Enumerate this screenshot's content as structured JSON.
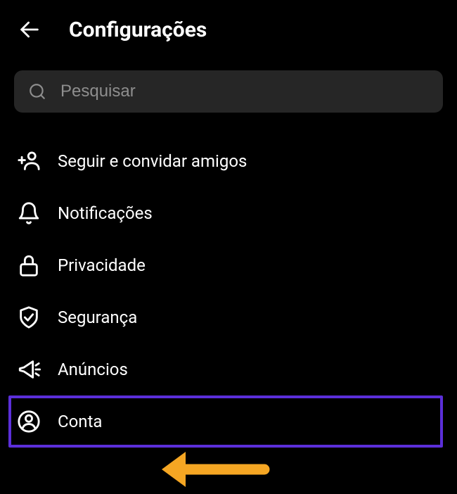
{
  "header": {
    "title": "Configurações"
  },
  "search": {
    "placeholder": "Pesquisar"
  },
  "menu": {
    "items": [
      {
        "label": "Seguir e convidar amigos"
      },
      {
        "label": "Notificações"
      },
      {
        "label": "Privacidade"
      },
      {
        "label": "Segurança"
      },
      {
        "label": "Anúncios"
      },
      {
        "label": "Conta"
      }
    ]
  }
}
